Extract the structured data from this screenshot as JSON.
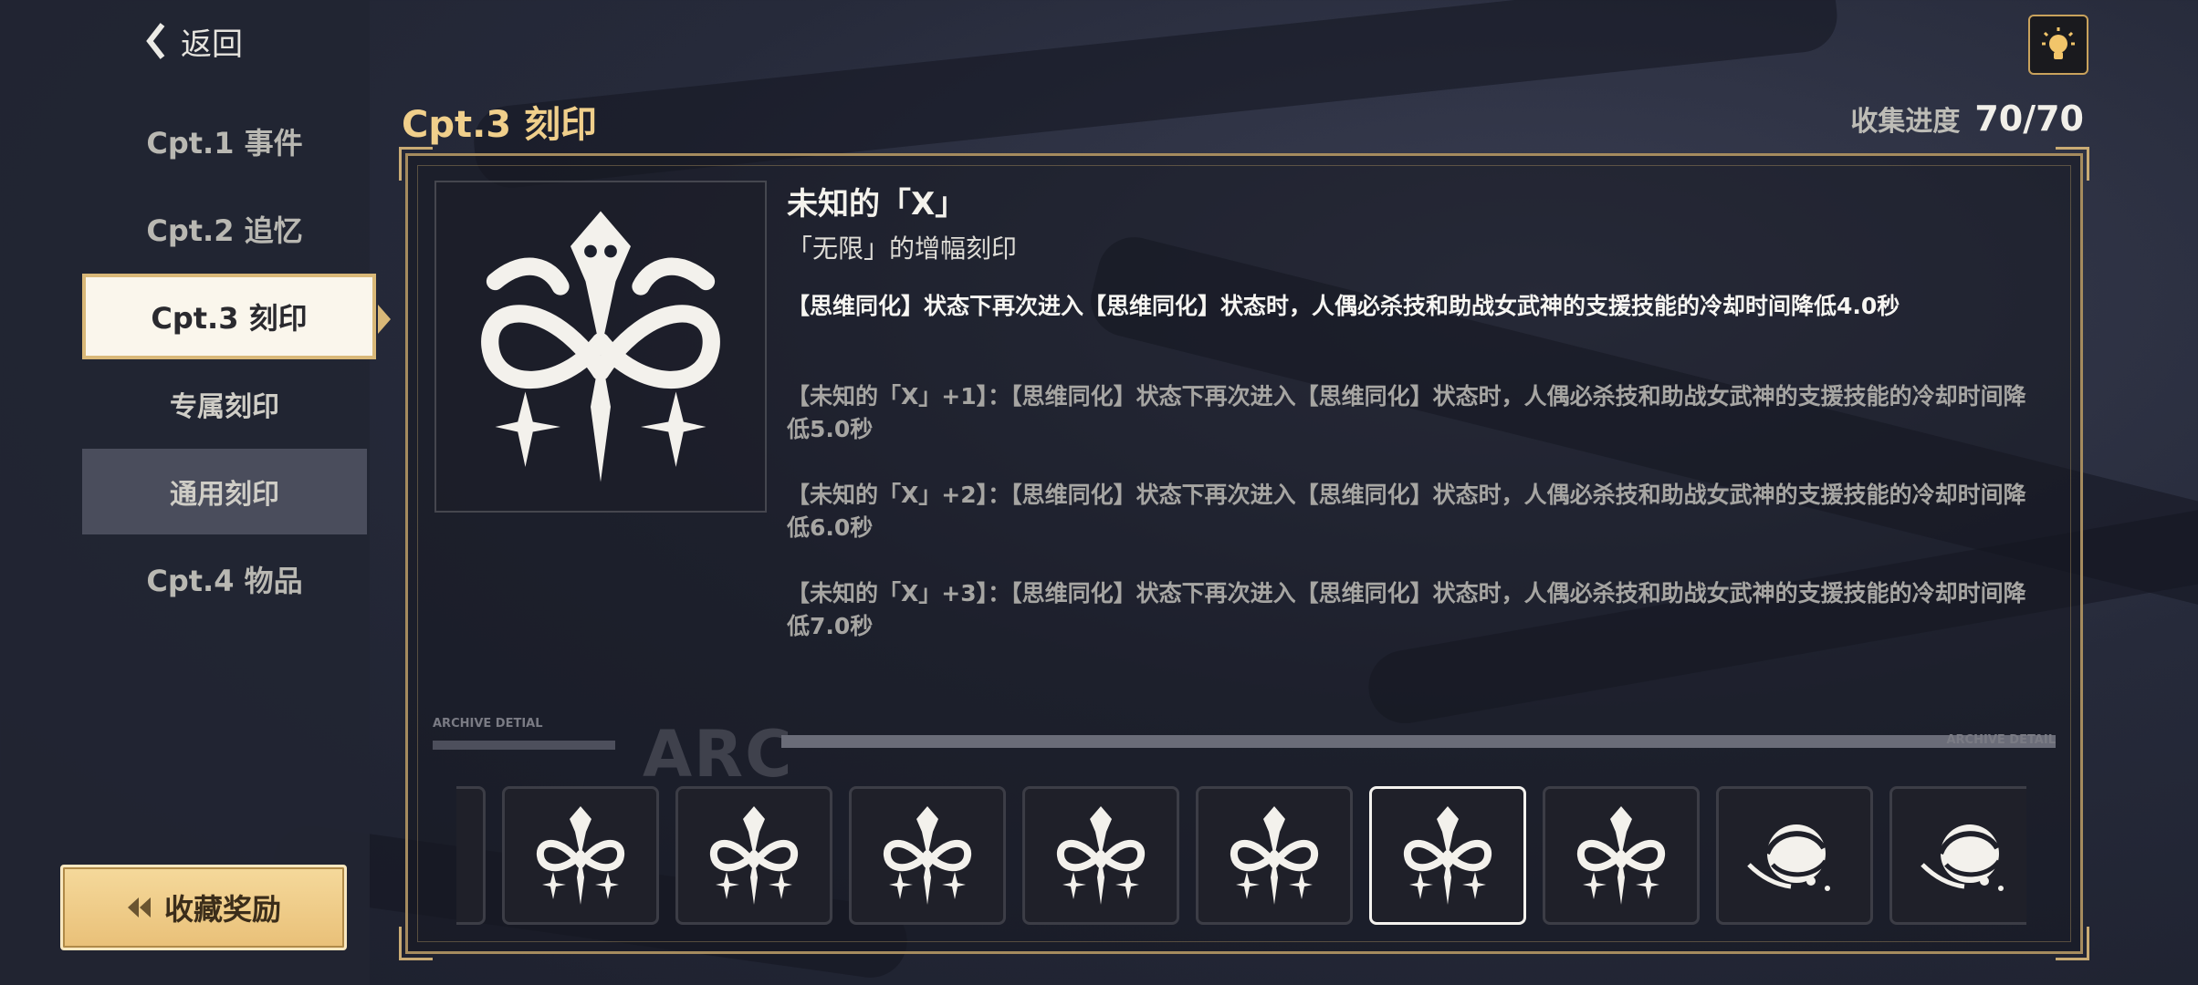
{
  "header": {
    "back_label": "返回",
    "chapter_title": "Cpt.3 刻印",
    "progress_label": "收集进度",
    "progress_value": "70/70"
  },
  "sidebar": {
    "items": [
      {
        "label": "Cpt.1 事件"
      },
      {
        "label": "Cpt.2 追忆"
      },
      {
        "label": "Cpt.3 刻印"
      },
      {
        "label": "专属刻印"
      },
      {
        "label": "通用刻印"
      },
      {
        "label": "Cpt.4 物品"
      }
    ],
    "reward_button": "收藏奖励"
  },
  "detail": {
    "name": "未知的「X」",
    "type": "「无限」的增幅刻印",
    "description": "【思维同化】状态下再次进入【思维同化】状态时，人偶必杀技和助战女武神的支援技能的冷却时间降低4.0秒",
    "upgrades": [
      "【未知的「X」+1】：【思维同化】状态下再次进入【思维同化】状态时，人偶必杀技和助战女武神的支援技能的冷却时间降低5.0秒",
      "【未知的「X」+2】：【思维同化】状态下再次进入【思维同化】状态时，人偶必杀技和助战女武神的支援技能的冷却时间降低6.0秒",
      "【未知的「X」+3】：【思维同化】状态下再次进入【思维同化】状态时，人偶必杀技和助战女武神的支援技能的冷却时间降低7.0秒"
    ]
  },
  "archive": {
    "left_label": "ARCHIVE DETIAL",
    "big_label": "ARC",
    "right_label": "ARCHIVE DETAIL"
  },
  "icons": {
    "back": "chevron-left-icon",
    "hint": "lightbulb-icon",
    "reward": "double-chevron-left-icon",
    "emblem": "serpent-emblem-icon",
    "emblem_alt": "swirl-emblem-icon"
  },
  "colors": {
    "accent_gold": "#f0cf8b",
    "frame_gold": "#a58b5e",
    "button_gold": "#e9c078"
  }
}
